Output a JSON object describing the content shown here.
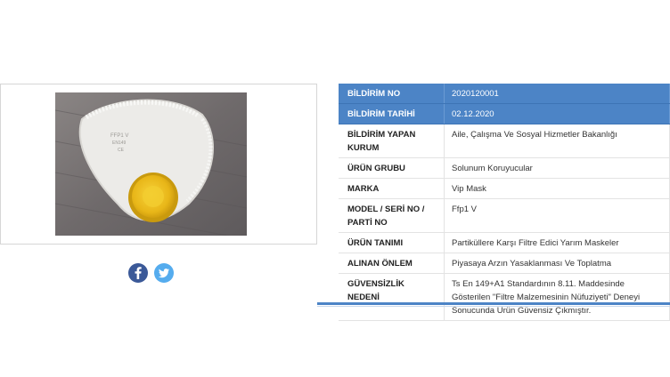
{
  "social": {
    "facebook_icon": "facebook-icon",
    "twitter_icon": "twitter-icon",
    "facebook_color": "#3b5998",
    "twitter_color": "#55acee"
  },
  "product_image": {
    "subject": "FFP1 V mask"
  },
  "header_color": "#4c84c6",
  "rows": [
    {
      "key": "BİLDİRİM NO",
      "value": "2020120001",
      "header": true
    },
    {
      "key": "BİLDİRİM TARİHİ",
      "value": "02.12.2020",
      "header": true
    },
    {
      "key": "BİLDİRİM YAPAN KURUM",
      "value": "Aile, Çalışma Ve Sosyal Hizmetler Bakanlığı"
    },
    {
      "key": "ÜRÜN GRUBU",
      "value": "Solunum Koruyucular"
    },
    {
      "key": "MARKA",
      "value": "Vip Mask"
    },
    {
      "key": "MODEL / SERİ NO / PARTİ NO",
      "value": "Ffp1 V"
    },
    {
      "key": "ÜRÜN TANIMI",
      "value": "Partiküllere Karşı Filtre Edici Yarım Maskeler"
    },
    {
      "key": "ALINAN ÖNLEM",
      "value": "Piyasaya Arzın Yasaklanması Ve Toplatma"
    },
    {
      "key": "GÜVENSİZLİK NEDENİ",
      "value": "Ts En 149+A1 Standardının 8.11. Maddesinde Gösterilen \"Filtre Malzemesinin Nüfuziyeti\" Deneyi Sonucunda Ürün Güvensiz Çıkmıştır."
    }
  ]
}
